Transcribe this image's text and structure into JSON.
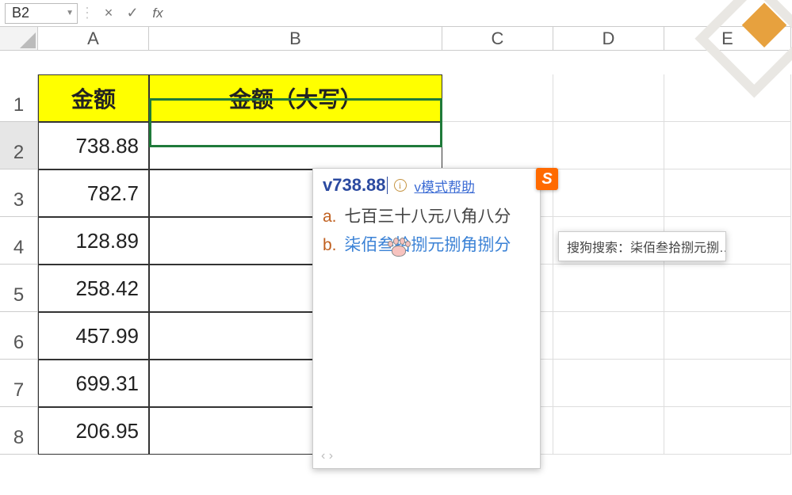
{
  "formula_bar": {
    "cell_ref": "B2",
    "fx_label": "fx",
    "cancel_glyph": "×",
    "confirm_glyph": "✓",
    "sep_glyph": "⋮",
    "value": ""
  },
  "columns": [
    "A",
    "B",
    "C",
    "D",
    "E"
  ],
  "rows": [
    "1",
    "2",
    "3",
    "4",
    "5",
    "6",
    "7",
    "8"
  ],
  "headers": {
    "A": "金额",
    "B": "金额（大写）"
  },
  "amounts": [
    "738.88",
    "782.7",
    "128.89",
    "258.42",
    "457.99",
    "699.31",
    "206.95"
  ],
  "ime": {
    "typed": "v738.88",
    "help_link": "v模式帮助",
    "candidates": [
      {
        "label": "a.",
        "text": "七百三十八元八角八分"
      },
      {
        "label": "b.",
        "text": "柒佰叁拾捌元捌角捌分"
      }
    ],
    "pager": "‹ ›",
    "sogou_badge": "S",
    "side_hint": "搜狗搜索：柒佰叁拾捌元捌…"
  }
}
